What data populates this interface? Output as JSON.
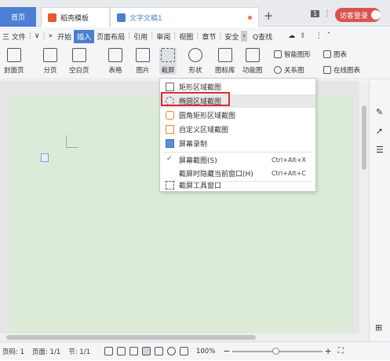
{
  "tabs": {
    "home": "首页",
    "daoke": "稻壳模板",
    "doc": "文字文稿1",
    "new_tab": "+"
  },
  "window": {
    "page_num": "1",
    "login": "访客登录"
  },
  "menubar": {
    "file": "三 文件",
    "more": "»",
    "items": [
      "开始",
      "插入",
      "页面布局",
      "引用",
      "审阅",
      "视图",
      "章节",
      "安全"
    ],
    "active_index": 1,
    "search": "Q查找"
  },
  "ribbon": {
    "cover": "封面页",
    "pagebreak": "分页",
    "blank": "空白页",
    "table": "表格",
    "picture": "图片",
    "screenshot": "截屏",
    "shape": "形状",
    "iconlib": "图标库",
    "funcchart": "功能图",
    "smartshape": "智能图形",
    "chart": "图表",
    "relation": "关系图",
    "onlinechart": "在线图表"
  },
  "dropdown": {
    "items": [
      {
        "label": "矩形区域截图",
        "shortcut": ""
      },
      {
        "label": "椭圆区域截图",
        "shortcut": ""
      },
      {
        "label": "圆角矩形区域截图",
        "shortcut": ""
      },
      {
        "label": "自定义区域截图",
        "shortcut": ""
      },
      {
        "label": "屏幕录制",
        "shortcut": ""
      },
      {
        "label": "屏幕截图(S)",
        "shortcut": "Ctrl+Alt+X"
      },
      {
        "label": "截屏时隐藏当前窗口(H)",
        "shortcut": "Ctrl+Alt+C"
      },
      {
        "label": "截屏工具窗口",
        "shortcut": ""
      }
    ],
    "highlighted_index": 1,
    "checked_index": 5
  },
  "status": {
    "page": "页码: 1",
    "pages": "页面: 1/1",
    "section": "节: 1/1",
    "zoom": "100%",
    "zoom_minus": "−",
    "zoom_plus": "+"
  },
  "colors": {
    "accent": "#4a7fd4",
    "login": "#d9534f",
    "highlight_box": "#d32f2f",
    "page_bg": "#dcebd8"
  }
}
